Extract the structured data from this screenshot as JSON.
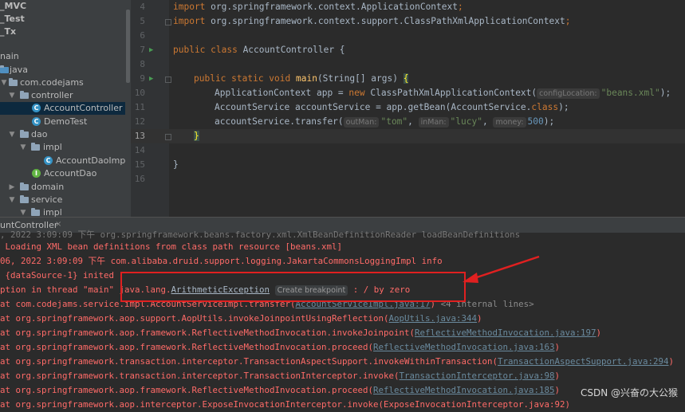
{
  "tree": {
    "items": [
      {
        "label": "_MVC",
        "bold": true
      },
      {
        "label": "_Test",
        "bold": true
      },
      {
        "label": "_Tx",
        "bold": true
      },
      {
        "label": "nain"
      },
      {
        "label": "java"
      },
      {
        "label": "com.codejams"
      },
      {
        "label": "controller"
      },
      {
        "label": "AccountController",
        "selected": true
      },
      {
        "label": "DemoTest"
      },
      {
        "label": "dao"
      },
      {
        "label": "impl"
      },
      {
        "label": "AccountDaoImpl"
      },
      {
        "label": "AccountDao"
      },
      {
        "label": "domain"
      },
      {
        "label": "service"
      },
      {
        "label": "impl"
      }
    ]
  },
  "editor": {
    "line_numbers": [
      "4",
      "5",
      "6",
      "7",
      "8",
      "9",
      "10",
      "11",
      "12",
      "13",
      "14",
      "15",
      "16"
    ],
    "lines": {
      "l4_import": "import ",
      "l4_path": "org.springframework.context.ApplicationContext",
      "l4_semi": ";",
      "l5_import": "import ",
      "l5_path": "org.springframework.context.support.ClassPathXmlApplicationContext",
      "l5_semi": ";",
      "l7_kw": "public class ",
      "l7_name": "AccountController {",
      "l9_kw": "public static void ",
      "l9_fn": "main",
      "l9_rest": "(String[] args) ",
      "l9_brace": "{",
      "l10_a": "ApplicationContext app = ",
      "l10_new": "new ",
      "l10_b": "ClassPathXmlApplicationContext(",
      "l10_hint": "configLocation:",
      "l10_str": "\"beans.xml\"",
      "l10_c": ");",
      "l11_a": "AccountService accountService = app.getBean(AccountService.",
      "l11_kw": "class",
      "l11_b": ");",
      "l12_a": "accountService.transfer(",
      "l12_hint1": "outMan:",
      "l12_str1": "\"tom\"",
      "l12_comma1": ", ",
      "l12_hint2": "inMan:",
      "l12_str2": "\"lucy\"",
      "l12_comma2": ", ",
      "l12_hint3": "money:",
      "l12_num": "500",
      "l12_b": ");",
      "l13_brace": "}",
      "l15_brace": "}"
    }
  },
  "run_panel": {
    "tab_label": "untController",
    "close": "×"
  },
  "console": {
    "line0": ", 2022 3:09:09 下午 org.springframework.beans.factory.xml.XmlBeanDefinitionReader loadBeanDefinitions",
    "line1": " Loading XML bean definitions from class path resource [beans.xml]",
    "line2": "06, 2022 3:09:09 下午 com.alibaba.druid.support.logging.JakartaCommonsLoggingImpl info",
    "line3": " {dataSource-1} inited",
    "line4_a": "ption in thread \"main\" ",
    "line4_b": "java.lang.",
    "line4_exc": "ArithmeticException",
    "line4_tag": "Create breakpoint",
    "line4_c": " : / by zero",
    "line5_a": "at com.codejams.service.impl.AccountServiceImpl.transfer(",
    "line5_link": "AccountServiceImpl.java:17",
    "line5_b": ") ",
    "line5_internal": "<4 internal lines>",
    "line6_a": "at org.springframework.aop.support.AopUtils.invokeJoinpointUsingReflection(",
    "line6_link": "AopUtils.java:344",
    "line6_b": ")",
    "line7_a": "at org.springframework.aop.framework.ReflectiveMethodInvocation.invokeJoinpoint(",
    "line7_link": "ReflectiveMethodInvocation.java:197",
    "line7_b": ")",
    "line8_a": "at org.springframework.aop.framework.ReflectiveMethodInvocation.proceed(",
    "line8_link": "ReflectiveMethodInvocation.java:163",
    "line8_b": ")",
    "line9_a": "at org.springframework.transaction.interceptor.TransactionAspectSupport.invokeWithinTransaction(",
    "line9_link": "TransactionAspectSupport.java:294",
    "line9_b": ")",
    "line10_a": "at org.springframework.transaction.interceptor.TransactionInterceptor.invoke(",
    "line10_link": "TransactionInterceptor.java:98",
    "line10_b": ")",
    "line11_a": "at org.springframework.aop.framework.ReflectiveMethodInvocation.proceed(",
    "line11_link": "ReflectiveMethodInvocation.java:185",
    "line11_b": ")",
    "line12": "at org.springframework.aop.interceptor.ExposeInvocationInterceptor.invoke(ExposeInvocationInterceptor.java:92)"
  },
  "watermark": "CSDN @兴奋の大公猴",
  "colors": {
    "error": "#ff6b68",
    "keyword": "#cc7832",
    "string": "#6a8759",
    "annotation_box": "#e02020"
  }
}
